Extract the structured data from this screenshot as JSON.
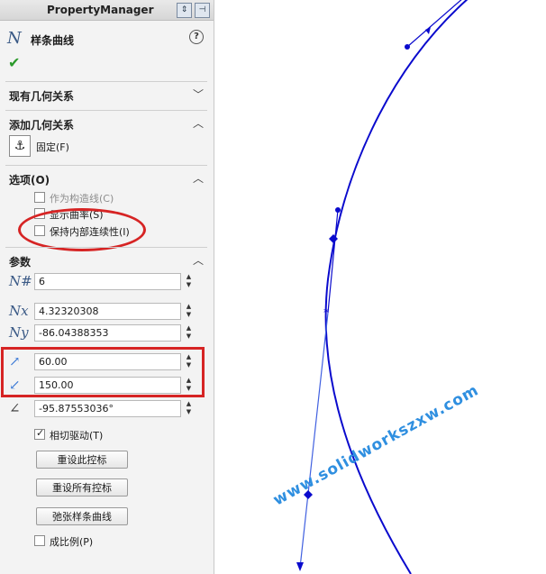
{
  "header": {
    "title": "PropertyManager"
  },
  "feature": {
    "name": "样条曲线"
  },
  "sections": {
    "existing_relations": "现有几何关系",
    "add_relations": "添加几何关系",
    "options": "选项(O)",
    "parameters": "参数"
  },
  "relation": {
    "fixed_label": "固定(F)"
  },
  "options": {
    "construction": "作为构造线(C)",
    "show_curvature": "显示曲率(S)",
    "keep_continuity": "保持内部连续性(I)"
  },
  "params": {
    "point_count": "6",
    "x_coord": "4.32320308",
    "y_coord": "-86.04388353",
    "tangent_weight_1": "60.00",
    "tangent_weight_2": "150.00",
    "tangent_angle": "-95.87553036°"
  },
  "tangent_driving": "相切驱动(T)",
  "buttons": {
    "reset_handle": "重设此控标",
    "reset_all": "重设所有控标",
    "relax_spline": "弛张样条曲线"
  },
  "proportional": "成比例(P)",
  "watermark": "www.solidworkszxw.com",
  "colors": {
    "curve": "#0a0acd",
    "annotation": "#d62424",
    "watermark": "#2f8fe0"
  }
}
